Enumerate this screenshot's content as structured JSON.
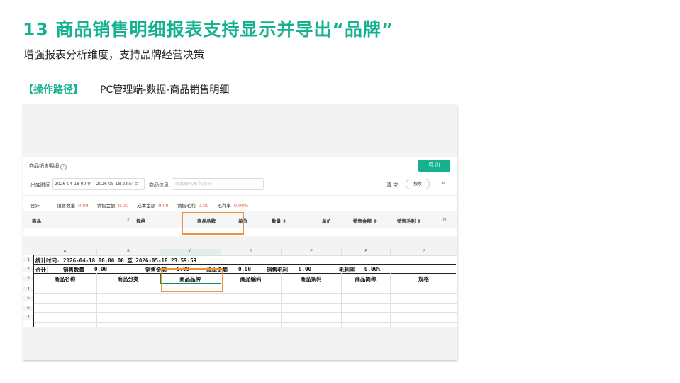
{
  "slide": {
    "title": "13  商品销售明细报表支持显示并导出“品牌”",
    "subtitle": "增强报表分析维度，支持品牌经营决策",
    "path_label": "【操作路径】",
    "path_text": "PC管理端-数据-商品销售明细"
  },
  "panel": {
    "title": "商品销售明细",
    "help_icon": "?",
    "export": "导 出",
    "filter": {
      "date_label": "出库时间",
      "date_value": "2026-04-18 00:0( - 2026-05-18 23:5! ⊡",
      "goods_label": "商品信息",
      "goods_placeholder": "商品编码/名称/条码",
      "clear": "清 空",
      "search": "搜索",
      "expand_icon": "≫"
    },
    "totals": {
      "label": "合计",
      "qty_label": "销售数量",
      "qty": "0.00",
      "amount_label": "销售金额",
      "amount": "0.00",
      "cost_label": "成本金额",
      "cost": "0.00",
      "profit_label": "销售毛利",
      "profit": "0.00",
      "rate_label": "毛利率",
      "rate": "0.00%"
    },
    "columns": [
      "商品",
      "⇕",
      "规格",
      "商品品牌",
      "单位",
      "数量 ⇕",
      "单价",
      "销售金额 ⇕",
      "销售毛利 ⇕",
      "⚙"
    ]
  },
  "sheet": {
    "col_letters": [
      "A",
      "B",
      "C",
      "D",
      "E",
      "F",
      "G"
    ],
    "row_numbers": [
      "1",
      "2",
      "3",
      "4",
      "5",
      "6",
      "7"
    ],
    "row1": "统计时间: 2026-04-18 00:00:00 至 2026-05-18 23:59:59",
    "row2": {
      "total": "合计|",
      "qty_label": "销售数量",
      "qty": "0.00",
      "amount_label": "销售金额",
      "amount": "0.00",
      "cost_label": "成本金额",
      "cost": "0.00",
      "profit_label": "销售毛利",
      "profit": "0.00",
      "rate_label": "毛利率",
      "rate": "0.00%"
    },
    "headers": [
      "商品名称",
      "商品分类",
      "商品品牌",
      "商品编码",
      "商品条码",
      "商品简称",
      "规格"
    ]
  },
  "colors": {
    "accent": "#16b28f",
    "highlight": "#f0923a",
    "negative": "#e8503a"
  }
}
